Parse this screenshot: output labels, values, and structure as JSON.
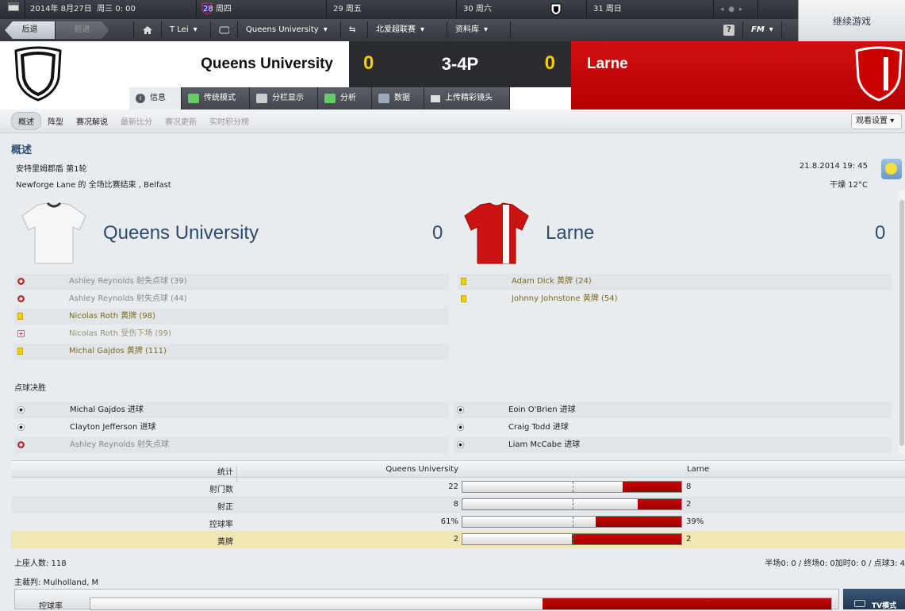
{
  "topbar": {
    "date": "2014年 8月27日",
    "weekday": "周三",
    "time": "0: 00",
    "days": [
      {
        "label": "28 周四"
      },
      {
        "label": "29 周五"
      },
      {
        "label": "30 周六"
      },
      {
        "label": "31 周日"
      }
    ],
    "continue": "继续游戏"
  },
  "nav": {
    "back": "后退",
    "forward": "前进",
    "manager": "T Lei",
    "club": "Queens University",
    "league": "北爱超联赛",
    "database": "资料库",
    "fm": "FM"
  },
  "match": {
    "home": "Queens University",
    "away": "Larne",
    "home_score": "0",
    "away_score": "0",
    "result": "3-4P"
  },
  "tabs": [
    {
      "label": "信息"
    },
    {
      "label": "传统模式"
    },
    {
      "label": "分栏显示"
    },
    {
      "label": "分析"
    },
    {
      "label": "数据"
    },
    {
      "label": "上传精彩镜头"
    }
  ],
  "subtabs": [
    {
      "label": "概述"
    },
    {
      "label": "阵型"
    },
    {
      "label": "赛况解说"
    },
    {
      "label": "最新比分"
    },
    {
      "label": "赛况更新"
    },
    {
      "label": "实时积分榜"
    }
  ],
  "view_settings": "观看设置",
  "overview": {
    "title": "概述",
    "competition": "安特里姆郡盾 第1轮",
    "venue": "Newforge Lane 的 全场比赛结束 , Belfast",
    "datetime": "21.8.2014 19: 45",
    "weather": "干燥 12°C"
  },
  "home_events": [
    {
      "text": "Ashley Reynolds 射失点球 (39)",
      "type": "miss"
    },
    {
      "text": "Ashley Reynolds 射失点球 (44)",
      "type": "miss"
    },
    {
      "text": "Nicolas Roth 黄牌 (98)",
      "type": "yellow"
    },
    {
      "text": "Nicolas Roth 受伤下场 (99)",
      "type": "injury"
    },
    {
      "text": "Michal Gajdos 黄牌 (111)",
      "type": "yellow"
    }
  ],
  "away_events": [
    {
      "text": "Adam Dick 黄牌 (24)",
      "type": "yellow"
    },
    {
      "text": "Johnny Johnstone 黄牌 (54)",
      "type": "yellow"
    }
  ],
  "penalties": {
    "title": "点球决胜",
    "home": [
      {
        "text": "Michal Gajdos 进球",
        "type": "goal"
      },
      {
        "text": "Clayton Jefferson 进球",
        "type": "goal"
      },
      {
        "text": "Ashley Reynolds 射失点球",
        "type": "miss"
      }
    ],
    "away": [
      {
        "text": "Eoin O'Brien 进球",
        "type": "goal"
      },
      {
        "text": "Craig Todd 进球",
        "type": "goal"
      },
      {
        "text": "Liam McCabe 进球",
        "type": "goal"
      }
    ]
  },
  "stats": {
    "header": "统计",
    "home": "Queens University",
    "away": "Larne",
    "rows": [
      {
        "label": "射门数",
        "home": "22",
        "away": "8",
        "home_share": 0.733
      },
      {
        "label": "射正",
        "home": "8",
        "away": "2",
        "home_share": 0.8
      },
      {
        "label": "控球率",
        "home": "61%",
        "away": "39%",
        "home_share": 0.61
      },
      {
        "label": "黄牌",
        "home": "2",
        "away": "2",
        "home_share": 0.5,
        "highlight": true
      }
    ]
  },
  "footer": {
    "attendance": "上座人数: 118",
    "halftime": "半场0: 0 / 终场0: 0加时0: 0 / 点球3: 4",
    "referee": "主裁判: Mulholland, M",
    "possession_label": "控球率",
    "tv": "TV模式"
  },
  "colors": {
    "away": "#c00000",
    "home": "#ffffff",
    "accent": "#2d4c6e"
  }
}
